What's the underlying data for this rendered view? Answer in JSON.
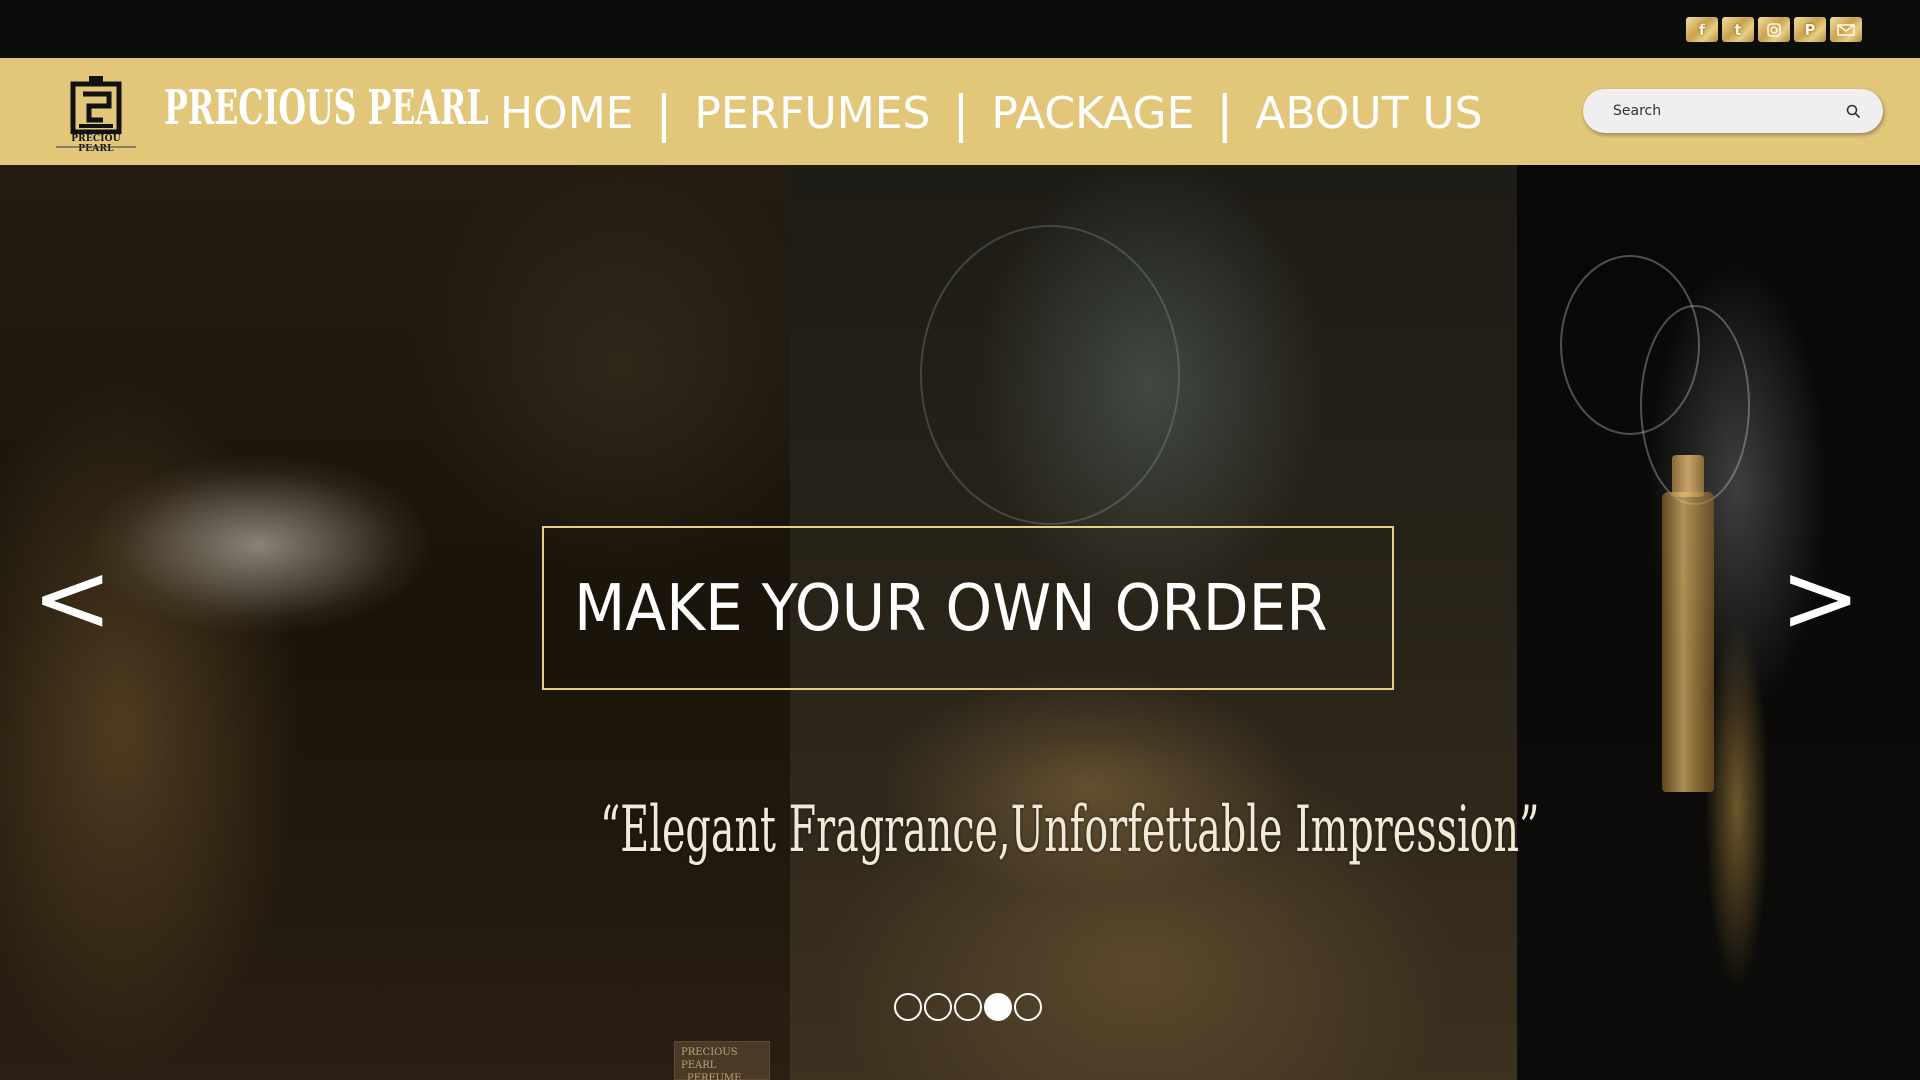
{
  "social": {
    "icons": [
      {
        "name": "facebook-icon",
        "glyph": "f"
      },
      {
        "name": "twitter-icon",
        "glyph": "t"
      },
      {
        "name": "instagram-icon",
        "glyph": ""
      },
      {
        "name": "pinterest-icon",
        "glyph": "P"
      },
      {
        "name": "mail-icon",
        "glyph": ""
      }
    ],
    "accent": "#d4b26a"
  },
  "header": {
    "logo_caption": "PRECIOU PEARL",
    "brand": "PRECIOUS PEARL",
    "nav": [
      {
        "label": "HOME"
      },
      {
        "label": "PERFUMES"
      },
      {
        "label": "PACKAGE"
      },
      {
        "label": "ABOUT US"
      }
    ],
    "nav_separator": "|",
    "background": "#e2c77b"
  },
  "search": {
    "placeholder": "Search",
    "value": ""
  },
  "hero": {
    "prev_label": "<",
    "next_label": ">",
    "cta": "MAKE YOUR OWN ORDER",
    "tagline": "“Elegant Fragrance,Unforfettable Impression”",
    "slides": 5,
    "active_slide": 4,
    "bottle_label": [
      "PRECIOUS PEARL",
      "PERFUME"
    ]
  }
}
